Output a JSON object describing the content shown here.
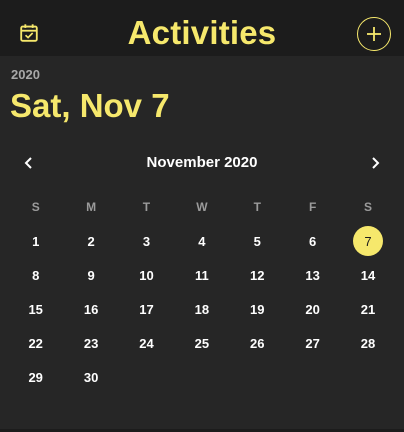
{
  "header": {
    "title": "Activities",
    "left_icon": "calendar-check-icon",
    "right_icon": "plus-icon"
  },
  "picker": {
    "year": "2020",
    "selected_date": "Sat, Nov 7",
    "month_label": "November 2020",
    "prev_icon": "chevron-left-icon",
    "next_icon": "chevron-right-icon",
    "weekdays": [
      "S",
      "M",
      "T",
      "W",
      "T",
      "F",
      "S"
    ],
    "first_weekday_offset": 0,
    "days": [
      1,
      2,
      3,
      4,
      5,
      6,
      7,
      8,
      9,
      10,
      11,
      12,
      13,
      14,
      15,
      16,
      17,
      18,
      19,
      20,
      21,
      22,
      23,
      24,
      25,
      26,
      27,
      28,
      29,
      30
    ],
    "selected_day": 7
  },
  "colors": {
    "accent": "#f6e86c",
    "background": "#1c1c1c",
    "panel": "#262626",
    "text": "#ffffff",
    "muted": "#9b9b9b"
  }
}
